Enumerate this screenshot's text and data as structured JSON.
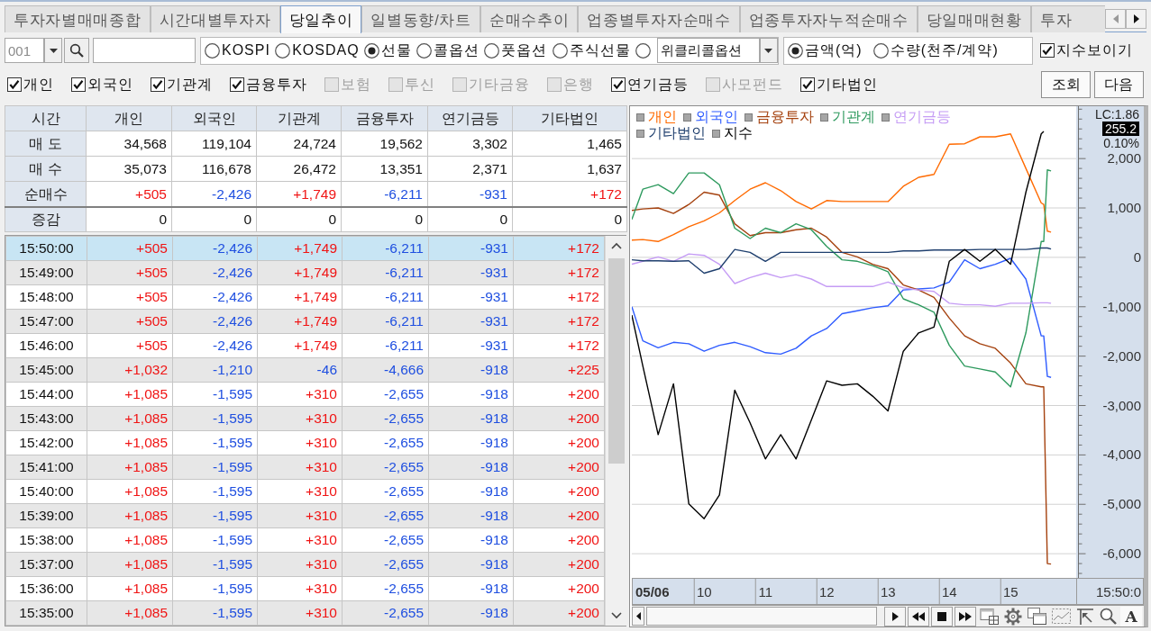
{
  "tabs": [
    {
      "label": "투자자별매매종합",
      "selected": false
    },
    {
      "label": "시간대별투자자",
      "selected": false
    },
    {
      "label": "당일추이",
      "selected": true
    },
    {
      "label": "일별동향/차트",
      "selected": false
    },
    {
      "label": "순매수추이",
      "selected": false
    },
    {
      "label": "업종별투자자순매수",
      "selected": false
    },
    {
      "label": "업종투자자누적순매수",
      "selected": false
    },
    {
      "label": "당일매매현황",
      "selected": false
    },
    {
      "label": "투자",
      "selected": false
    }
  ],
  "toolbar": {
    "code": "001",
    "market_options": [
      {
        "kind": "radio",
        "label": "KOSPI",
        "selected": false
      },
      {
        "kind": "radio",
        "label": "KOSDAQ",
        "selected": false
      },
      {
        "kind": "radio",
        "label": "선물",
        "selected": true
      },
      {
        "kind": "radio",
        "label": "콜옵션",
        "selected": false
      },
      {
        "kind": "radio",
        "label": "풋옵션",
        "selected": false
      },
      {
        "kind": "radio",
        "label": "주식선물",
        "selected": false
      },
      {
        "kind": "combo",
        "value": "위클리콜옵션",
        "selected": false
      }
    ],
    "unit_options": [
      {
        "label": "금액(억)",
        "selected": true
      },
      {
        "label": "수량(천주/계약)",
        "selected": false
      }
    ],
    "show_index": {
      "label": "지수보이기",
      "checked": true
    }
  },
  "filters": [
    {
      "label": "개인",
      "checked": true,
      "disabled": false
    },
    {
      "label": "외국인",
      "checked": true,
      "disabled": false
    },
    {
      "label": "기관계",
      "checked": true,
      "disabled": false
    },
    {
      "label": "금융투자",
      "checked": true,
      "disabled": false
    },
    {
      "label": "보험",
      "checked": false,
      "disabled": true
    },
    {
      "label": "투신",
      "checked": false,
      "disabled": true
    },
    {
      "label": "기타금융",
      "checked": false,
      "disabled": true
    },
    {
      "label": "은행",
      "checked": false,
      "disabled": true
    },
    {
      "label": "연기금등",
      "checked": true,
      "disabled": false
    },
    {
      "label": "사모펀드",
      "checked": false,
      "disabled": true
    },
    {
      "label": "기타법인",
      "checked": true,
      "disabled": false
    }
  ],
  "buttons": [
    "조회",
    "다음"
  ],
  "summary_table": {
    "columns": [
      "시간",
      "개인",
      "외국인",
      "기관계",
      "금융투자",
      "연기금등",
      "기타법인"
    ],
    "rows": [
      {
        "cells": [
          "매 도",
          "34,568",
          "119,104",
          "24,724",
          "19,562",
          "3,302",
          "1,465"
        ]
      },
      {
        "cells": [
          "매 수",
          "35,073",
          "116,678",
          "26,472",
          "13,351",
          "2,371",
          "1,637"
        ]
      },
      {
        "cells": [
          "순매수",
          "+505",
          "-2,426",
          "+1,749",
          "-6,211",
          "-931",
          "+172"
        ]
      },
      {
        "cells": [
          "증감",
          "0",
          "0",
          "0",
          "0",
          "0",
          "0"
        ]
      }
    ]
  },
  "time_table": {
    "rows": [
      {
        "time": "15:50:00",
        "selected": true,
        "cells": [
          "+505",
          "-2,426",
          "+1,749",
          "-6,211",
          "-931",
          "+172"
        ]
      },
      {
        "time": "15:49:00",
        "selected": false,
        "cells": [
          "+505",
          "-2,426",
          "+1,749",
          "-6,211",
          "-931",
          "+172"
        ]
      },
      {
        "time": "15:48:00",
        "selected": false,
        "cells": [
          "+505",
          "-2,426",
          "+1,749",
          "-6,211",
          "-931",
          "+172"
        ]
      },
      {
        "time": "15:47:00",
        "selected": false,
        "cells": [
          "+505",
          "-2,426",
          "+1,749",
          "-6,211",
          "-931",
          "+172"
        ]
      },
      {
        "time": "15:46:00",
        "selected": false,
        "cells": [
          "+505",
          "-2,426",
          "+1,749",
          "-6,211",
          "-931",
          "+172"
        ]
      },
      {
        "time": "15:45:00",
        "selected": false,
        "cells": [
          "+1,032",
          "-1,210",
          "-46",
          "-4,666",
          "-918",
          "+225"
        ]
      },
      {
        "time": "15:44:00",
        "selected": false,
        "cells": [
          "+1,085",
          "-1,595",
          "+310",
          "-2,655",
          "-918",
          "+200"
        ]
      },
      {
        "time": "15:43:00",
        "selected": false,
        "cells": [
          "+1,085",
          "-1,595",
          "+310",
          "-2,655",
          "-918",
          "+200"
        ]
      },
      {
        "time": "15:42:00",
        "selected": false,
        "cells": [
          "+1,085",
          "-1,595",
          "+310",
          "-2,655",
          "-918",
          "+200"
        ]
      },
      {
        "time": "15:41:00",
        "selected": false,
        "cells": [
          "+1,085",
          "-1,595",
          "+310",
          "-2,655",
          "-918",
          "+200"
        ]
      },
      {
        "time": "15:40:00",
        "selected": false,
        "cells": [
          "+1,085",
          "-1,595",
          "+310",
          "-2,655",
          "-918",
          "+200"
        ]
      },
      {
        "time": "15:39:00",
        "selected": false,
        "cells": [
          "+1,085",
          "-1,595",
          "+310",
          "-2,655",
          "-918",
          "+200"
        ]
      },
      {
        "time": "15:38:00",
        "selected": false,
        "cells": [
          "+1,085",
          "-1,595",
          "+310",
          "-2,655",
          "-918",
          "+200"
        ]
      },
      {
        "time": "15:37:00",
        "selected": false,
        "cells": [
          "+1,085",
          "-1,595",
          "+310",
          "-2,655",
          "-918",
          "+200"
        ]
      },
      {
        "time": "15:36:00",
        "selected": false,
        "cells": [
          "+1,085",
          "-1,595",
          "+310",
          "-2,655",
          "-918",
          "+200"
        ]
      },
      {
        "time": "15:35:00",
        "selected": false,
        "cells": [
          "+1,085",
          "-1,595",
          "+310",
          "-2,655",
          "-918",
          "+200"
        ]
      }
    ]
  },
  "chart": {
    "upper_label": "LC:1.86",
    "price_marker": "255.2",
    "change_label": "0.10%",
    "date_label": "05/06",
    "time_label": "15:50:0",
    "text_tool": "A",
    "chart_data": {
      "type": "line",
      "grid": true,
      "x": [
        8.82,
        9,
        9.25,
        9.5,
        9.75,
        10,
        10.25,
        10.5,
        10.75,
        11,
        11.25,
        11.5,
        11.75,
        12,
        12.25,
        12.5,
        12.75,
        13,
        13.25,
        13.5,
        13.75,
        14,
        14.25,
        14.5,
        14.75,
        15,
        15.25,
        15.5,
        15.54,
        15.6,
        15.66
      ],
      "xlim": [
        8.82,
        16.07
      ],
      "ylim": [
        -6490,
        3060
      ],
      "xticks": [
        10,
        11,
        12,
        13,
        14,
        15
      ],
      "yticks": [
        {
          "value": 2000,
          "label": "2,000"
        },
        {
          "value": 1000,
          "label": "1,000"
        },
        {
          "value": 0,
          "label": "0"
        },
        {
          "value": -1000,
          "label": "-1,000"
        },
        {
          "value": -2000,
          "label": "-2,000"
        },
        {
          "value": -3000,
          "label": "-3,000"
        },
        {
          "value": -4000,
          "label": "-4,000"
        },
        {
          "value": -5000,
          "label": "-5,000"
        },
        {
          "value": -6000,
          "label": "-6,000"
        }
      ],
      "series": [
        {
          "name": "개인",
          "color": "#ff6a00",
          "values": [
            350,
            360,
            320,
            460,
            620,
            740,
            900,
            1150,
            1380,
            1510,
            1350,
            1130,
            980,
            1150,
            1130,
            1130,
            1130,
            1130,
            1440,
            1620,
            1680,
            2290,
            2300,
            2440,
            2440,
            2500,
            1800,
            1100,
            1070,
            530,
            510
          ]
        },
        {
          "name": "외국인",
          "color": "#2f5cff",
          "values": [
            -1000,
            -1690,
            -1830,
            -1720,
            -1750,
            -1900,
            -1780,
            -1720,
            -1810,
            -1930,
            -1960,
            -1840,
            -1590,
            -1440,
            -1140,
            -1080,
            -1020,
            -980,
            -660,
            -640,
            -620,
            -500,
            -50,
            -230,
            -140,
            -20,
            -440,
            -1590,
            -1590,
            -2410,
            -2430
          ]
        },
        {
          "name": "금융투자",
          "color": "#a5420f",
          "values": [
            950,
            980,
            1000,
            890,
            1070,
            1320,
            1260,
            680,
            440,
            500,
            500,
            560,
            590,
            410,
            100,
            10,
            -140,
            -230,
            -560,
            -660,
            -810,
            -1230,
            -1590,
            -1750,
            -1840,
            -2140,
            -2560,
            -2620,
            -2620,
            -6200,
            -6210
          ]
        },
        {
          "name": "기관계",
          "color": "#2e9a5e",
          "values": [
            770,
            1380,
            1470,
            1290,
            1710,
            1710,
            1470,
            590,
            380,
            590,
            500,
            680,
            560,
            220,
            -50,
            -80,
            -170,
            -290,
            -840,
            -960,
            -1110,
            -1780,
            -2200,
            -2260,
            -2320,
            -2620,
            -1530,
            320,
            320,
            1770,
            1750
          ]
        },
        {
          "name": "연기금등",
          "color": "#c59cf5",
          "values": [
            -140,
            -80,
            10,
            -80,
            70,
            40,
            -140,
            -530,
            -410,
            -320,
            -410,
            -350,
            -440,
            -590,
            -590,
            -590,
            -590,
            -500,
            -620,
            -660,
            -690,
            -930,
            -960,
            -960,
            -990,
            -930,
            -930,
            -920,
            -920,
            -920,
            -930
          ]
        },
        {
          "name": "기타법인",
          "color": "#1f3f6e",
          "values": [
            -50,
            -70,
            -70,
            -80,
            -70,
            -320,
            -230,
            160,
            100,
            -80,
            100,
            100,
            100,
            100,
            100,
            100,
            100,
            100,
            130,
            130,
            150,
            150,
            150,
            160,
            160,
            160,
            160,
            190,
            190,
            190,
            170
          ]
        },
        {
          "name": "지수",
          "color": "#000000",
          "values": [
            -1170,
            -2200,
            -3590,
            -2560,
            -4990,
            -5290,
            -4810,
            -2690,
            -3350,
            -4080,
            -3590,
            -4080,
            -3290,
            -2500,
            -2590,
            -2560,
            -2810,
            -3110,
            -1900,
            -1530,
            -1410,
            -80,
            160,
            -80,
            160,
            -140,
            1320,
            2500,
            2550,
            null,
            null
          ]
        }
      ]
    }
  }
}
